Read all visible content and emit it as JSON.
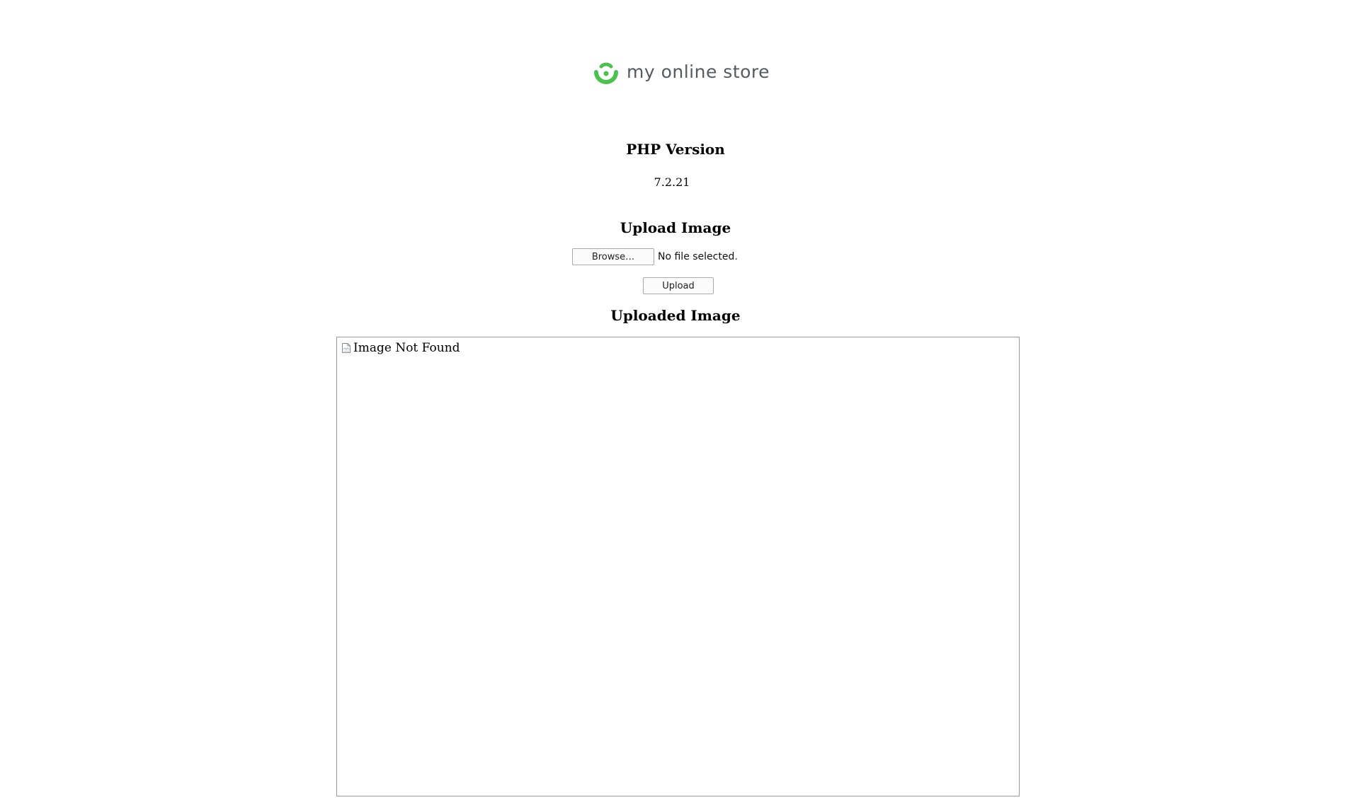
{
  "logo": {
    "text": "my online store",
    "accent_color": "#4cc24e",
    "icon": "smile-logo-icon"
  },
  "php_section": {
    "title": "PHP Version",
    "version": "7.2.21"
  },
  "upload_section": {
    "title": "Upload Image",
    "browse_label": "Browse…",
    "file_status": "No file selected.",
    "upload_label": "Upload"
  },
  "uploaded_section": {
    "title": "Uploaded Image",
    "image_alt": "Image Not Found",
    "broken_icon": "broken-image-icon"
  }
}
